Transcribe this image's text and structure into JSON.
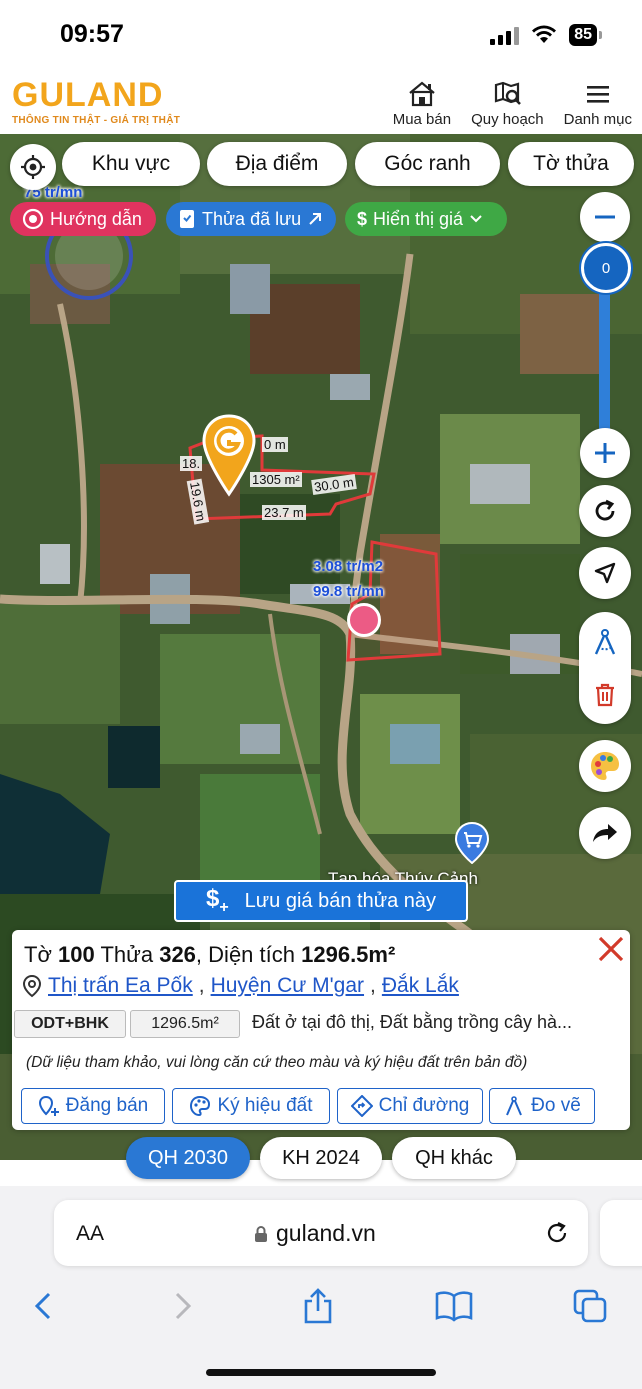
{
  "status": {
    "time": "09:57",
    "battery": "85"
  },
  "header": {
    "logo": "GULAND",
    "tagline": "THÔNG TIN THẬT - GIÁ TRỊ THẬT",
    "nav": [
      {
        "label": "Mua bán",
        "icon": "house-icon"
      },
      {
        "label": "Quy hoạch",
        "icon": "map-search-icon"
      },
      {
        "label": "Danh mục",
        "icon": "menu-icon"
      }
    ]
  },
  "filters": [
    "Khu vực",
    "Địa điểm",
    "Góc ranh",
    "Tờ thửa"
  ],
  "chips": {
    "guide": "Hướng dẫn",
    "saved": "Thửa đã lưu",
    "price": "Hiển thị giá"
  },
  "zoom": {
    "value": "0"
  },
  "map": {
    "price_labels": [
      {
        "per_m2": "3.08 tr/m2",
        "total": "99.8 tr/mn"
      }
    ],
    "corner_label": "75 tr/mn",
    "dimensions": [
      "18.",
      "0 m",
      "1305 m²",
      "30.0 m",
      "19.6 m",
      "23.7 m"
    ],
    "place": "Tạp hóa Thúy Cảnh"
  },
  "save_price_button": "Lưu giá bán thửa này",
  "parcel": {
    "sheet_label": "Tờ",
    "sheet_no": "100",
    "parcel_label": "Thửa",
    "parcel_no": "326",
    "area_label": "Diện tích",
    "area": "1296.5m²",
    "address": [
      "Thị trấn Ea Pốk",
      "Huyện Cư M'gar",
      "Đắk Lắk"
    ],
    "land_code": "ODT+BHK",
    "land_area": "1296.5m²",
    "purpose": "Đất ở tại đô thị, Đất bằng trồng cây hà...",
    "note": "(Dữ liệu tham khảo, vui lòng căn cứ theo màu và ký hiệu đất trên bản đồ)",
    "actions": [
      "Đăng bán",
      "Ký hiệu đất",
      "Chỉ đường",
      "Đo vẽ"
    ]
  },
  "plan_tabs": [
    "QH 2030",
    "KH 2024",
    "QH khác"
  ],
  "browser": {
    "aa": "AA",
    "host": "guland.vn"
  },
  "colors": {
    "brand": "#f2a51c",
    "primary": "#1a73d9",
    "active_tab": "#2a78d4",
    "boundary": "#e03a3a"
  }
}
